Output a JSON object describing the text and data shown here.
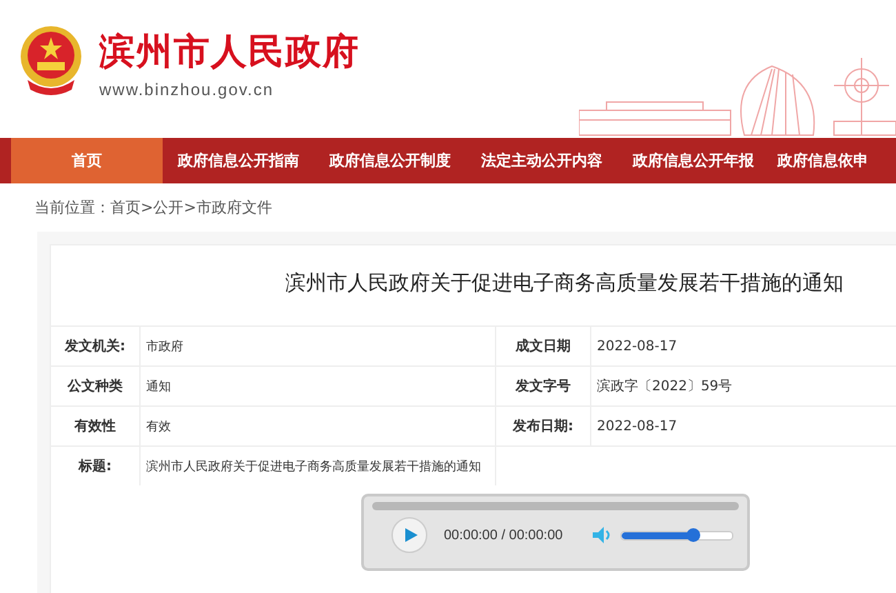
{
  "header": {
    "site_name": "滨州市人民政府",
    "url": "www.binzhou.gov.cn"
  },
  "nav": [
    {
      "label": "首页",
      "selected": true
    },
    {
      "label": "政府信息公开指南",
      "selected": false
    },
    {
      "label": "政府信息公开制度",
      "selected": false
    },
    {
      "label": "法定主动公开内容",
      "selected": false
    },
    {
      "label": "政府信息公开年报",
      "selected": false
    },
    {
      "label": "政府信息依申",
      "selected": false
    }
  ],
  "breadcrumb": "当前位置：首页>公开>市政府文件",
  "document": {
    "title": "滨州市人民政府关于促进电子商务高质量发展若干措施的通知",
    "fields": [
      [
        {
          "label": "发文机关:",
          "value": "市政府"
        },
        {
          "label": "成文日期",
          "value": "2022-08-17"
        }
      ],
      [
        {
          "label": "公文种类",
          "value": "通知"
        },
        {
          "label": "发文字号",
          "value": "滨政字〔2022〕59号"
        }
      ],
      [
        {
          "label": "有效性",
          "value": "有效"
        },
        {
          "label": "发布日期:",
          "value": "2022-08-17"
        }
      ],
      [
        {
          "label": "标题:",
          "value": "滨州市人民政府关于促进电子商务高质量发展若干措施的通知"
        }
      ]
    ]
  },
  "audio_player": {
    "time": "00:00:00 / 00:00:00",
    "volume": {
      "level": 0.65
    }
  }
}
